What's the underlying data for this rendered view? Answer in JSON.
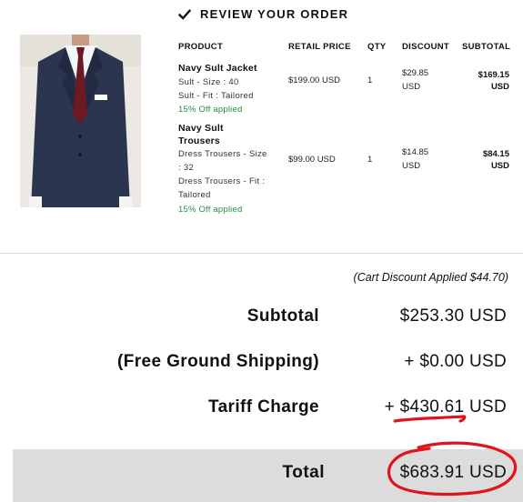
{
  "section_title": "REVIEW YOUR ORDER",
  "columns": {
    "product": "PRODUCT",
    "retail_price": "RETAIL PRICE",
    "qty": "QTY",
    "discount": "DISCOUNT",
    "subtotal": "SUBTOTAL"
  },
  "items": [
    {
      "name": "Navy Sult Jacket",
      "detail1": "Sult - Size : 40",
      "detail2": "Sult - Fit : Tailored",
      "offer": "15% Off applied",
      "retail_price": "$199.00 USD",
      "qty": "1",
      "discount_line1": "$29.85",
      "discount_line2": "USD",
      "subtotal_line1": "$169.15",
      "subtotal_line2": "USD"
    },
    {
      "name_line1": "Navy Sult",
      "name_line2": "Trousers",
      "detail1": "Dress Trousers - Size",
      "detail2": ": 32",
      "detail3": "Dress Trousers - Fit :",
      "detail4": "Tailored",
      "offer": "15% Off applied",
      "retail_price": "$99.00 USD",
      "qty": "1",
      "discount_line1": "$14.85",
      "discount_line2": "USD",
      "subtotal_line1": "$84.15",
      "subtotal_line2": "USD"
    }
  ],
  "cart_discount": "(Cart Discount Applied $44.70)",
  "summary": {
    "subtotal_label": "Subtotal",
    "subtotal_value": "$253.30 USD",
    "shipping_label": "(Free Ground Shipping)",
    "shipping_value": "+ $0.00 USD",
    "tariff_label": "Tariff Charge",
    "tariff_value": "+ $430.61 USD",
    "total_label": "Total",
    "total_value": "$683.91 USD"
  },
  "colors": {
    "offer_green": "#2a8b47",
    "annotation_red": "#e0141c",
    "total_band": "#dcdcdc"
  }
}
